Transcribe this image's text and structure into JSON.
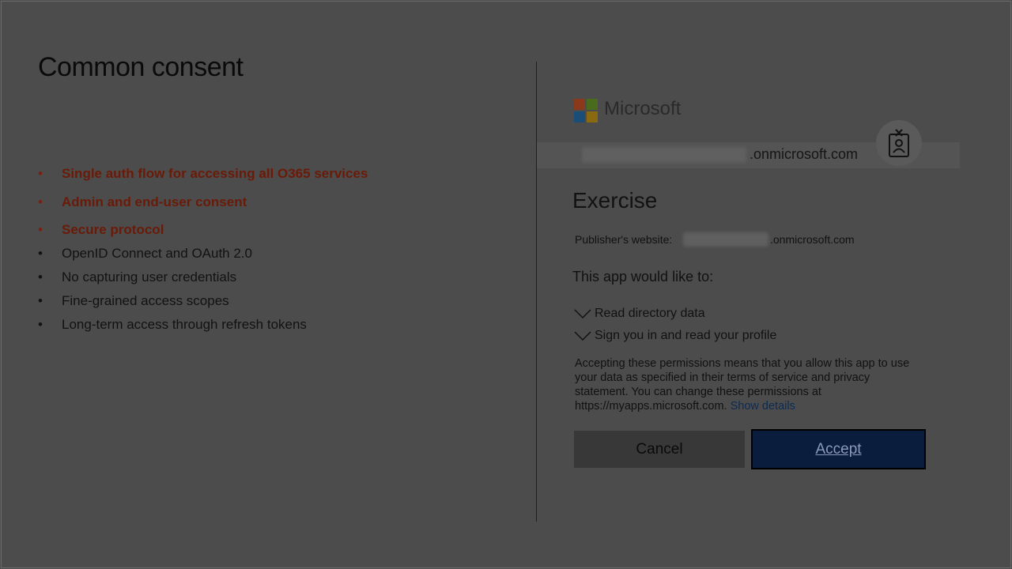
{
  "slide": {
    "title": "Common consent",
    "bullets": [
      {
        "text": "Single auth flow for accessing all O365 services",
        "highlight": true
      },
      {
        "text": "Admin and end-user consent",
        "highlight": true
      },
      {
        "text": "Secure protocol",
        "highlight": true
      },
      {
        "text": "OpenID Connect and OAuth 2.0",
        "highlight": false
      },
      {
        "text": "No capturing user credentials",
        "highlight": false
      },
      {
        "text": "Fine-grained access scopes",
        "highlight": false
      },
      {
        "text": "Long-term access through refresh tokens",
        "highlight": false
      }
    ],
    "bullet_glyph": "•"
  },
  "consent": {
    "brand": "Microsoft",
    "account_domain": ".onmicrosoft.com",
    "account_icon": "account-badge-icon",
    "app_name": "Exercise",
    "publisher_label": "Publisher's website:",
    "publisher_domain": ".onmicrosoft.com",
    "would_like": "This app would like to:",
    "permissions": [
      "Read directory data",
      "Sign you in and read your profile"
    ],
    "disclaimer": "Accepting these permissions means that you allow this app to use your data as specified in their terms of service and privacy statement. You can change these permissions at https://myapps.microsoft.com.",
    "show_details": "Show details",
    "cancel_label": "Cancel",
    "accept_label": "Accept"
  },
  "colors": {
    "highlight_text": "#6b1a08",
    "accept_button": "#0b1d3d",
    "logo_red": "#8a3a1a",
    "logo_green": "#4a6a1c",
    "logo_blue": "#1a4e78",
    "logo_yellow": "#8a6a10"
  }
}
